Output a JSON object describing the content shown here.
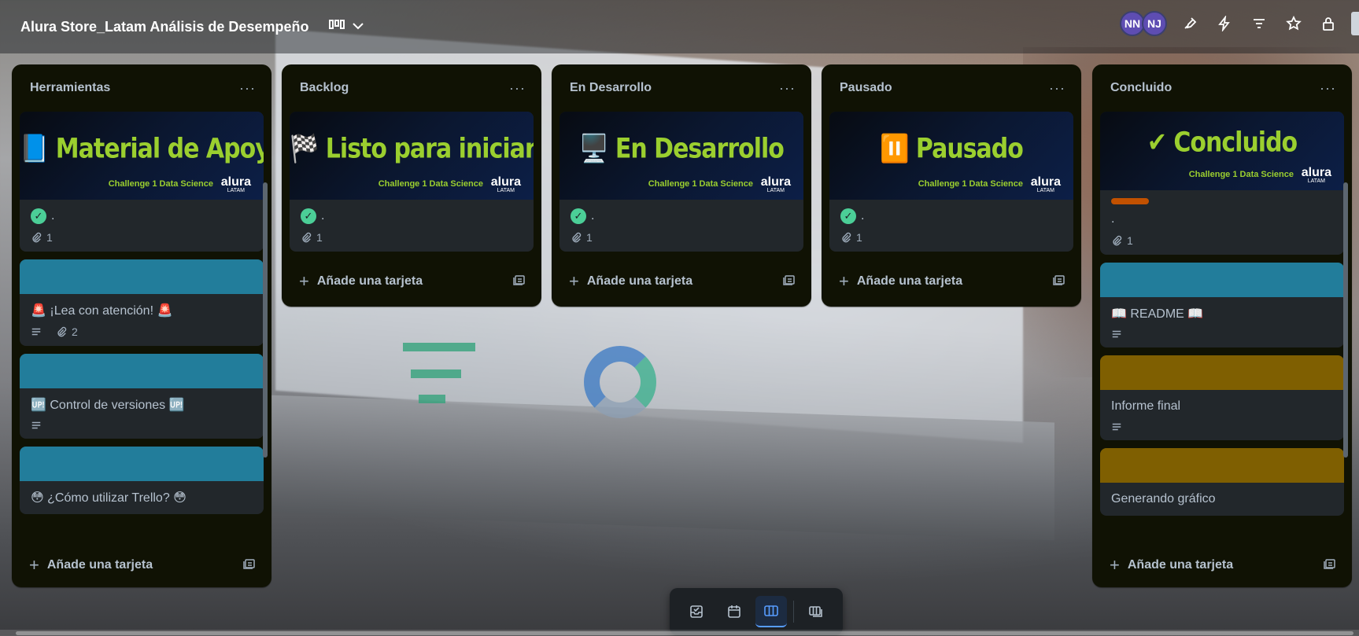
{
  "board": {
    "title": "Alura Store_Latam Análisis de Desempeño",
    "avatars": [
      "NN",
      "NJ"
    ]
  },
  "colors": {
    "list_bg": "#101204",
    "card_bg": "#22272b",
    "cover_teal": "#227d9b",
    "cover_olive": "#7f5f01",
    "label_orange": "#c25100",
    "check_green": "#4bce97",
    "accent_blue": "#579dff"
  },
  "cover_common": {
    "subtitle": "Challenge 1 Data Science",
    "logo_text": "alura",
    "logo_sub": "LATAM"
  },
  "lists": [
    {
      "title": "Herramientas",
      "cards": [
        {
          "cover_text": "📘 Material de Apoyo",
          "title": ".",
          "attachments": "1"
        },
        {
          "title": "🚨 ¡Lea con atención! 🚨",
          "attachments": "2"
        },
        {
          "title": "🆙 Control de versiones 🆙"
        },
        {
          "title": "😳 ¿Cómo utilizar Trello? 😳"
        }
      ],
      "add_label": "Añade una tarjeta"
    },
    {
      "title": "Backlog",
      "cards": [
        {
          "cover_text": "🏁 Listo para iniciar",
          "title": ".",
          "attachments": "1"
        }
      ],
      "add_label": "Añade una tarjeta"
    },
    {
      "title": "En Desarrollo",
      "cards": [
        {
          "cover_text": "🖥️ En Desarrollo",
          "title": ".",
          "attachments": "1"
        }
      ],
      "add_label": "Añade una tarjeta"
    },
    {
      "title": "Pausado",
      "cards": [
        {
          "cover_text": "⏸️ Pausado",
          "title": ".",
          "attachments": "1"
        }
      ],
      "add_label": "Añade una tarjeta"
    },
    {
      "title": "Concluido",
      "cards": [
        {
          "cover_text": "✔ Concluido",
          "title": ".",
          "attachments": "1"
        },
        {
          "title": "📖 README 📖"
        },
        {
          "title": "Informe final"
        },
        {
          "title": "Generando gráfico"
        }
      ],
      "add_label": "Añade una tarjeta"
    }
  ],
  "bottom_bar": [
    "inbox-icon",
    "calendar-icon",
    "board-icon",
    "switch-boards-icon"
  ]
}
